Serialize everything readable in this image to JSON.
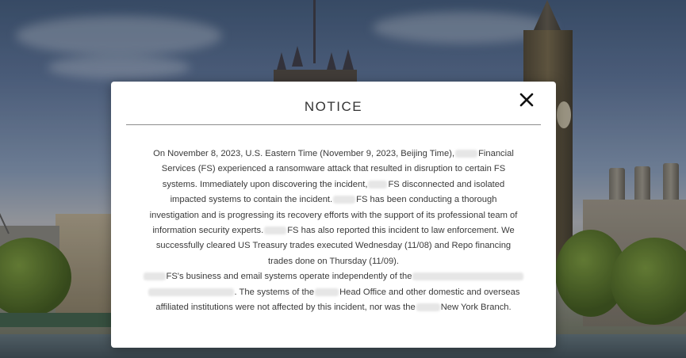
{
  "background": {
    "description_icon": "london-skyline-image"
  },
  "modal": {
    "title": "NOTICE",
    "close_icon": "close-icon",
    "paragraph1": {
      "l1a": "On November 8, 2023, U.S. Eastern Time (November 9, 2023, Beijing Time),",
      "l1b": "Financial",
      "l2": "Services (FS) experienced a ransomware attack that resulted in disruption to certain FS",
      "l3a": "systems. Immediately upon discovering the incident,",
      "l3b": "FS disconnected and isolated",
      "l4a": "impacted systems to contain the incident.",
      "l4b": "FS has been conducting a thorough",
      "l5": "investigation and is progressing its recovery efforts with the support of its professional team of",
      "l6a": "information security experts.",
      "l6b": "FS has also reported this incident to law enforcement. We",
      "l7": "successfully cleared US Treasury trades executed Wednesday (11/08) and Repo financing",
      "l8": "trades done on Thursday (11/09)."
    },
    "paragraph2": {
      "l1a": "FS's business and email systems operate independently of the",
      "l2a": ". The systems of the",
      "l2b": "Head Office and other domestic and overseas",
      "l3a": "affiliated institutions were not affected by this incident, nor was the",
      "l3b": "New York Branch."
    }
  }
}
